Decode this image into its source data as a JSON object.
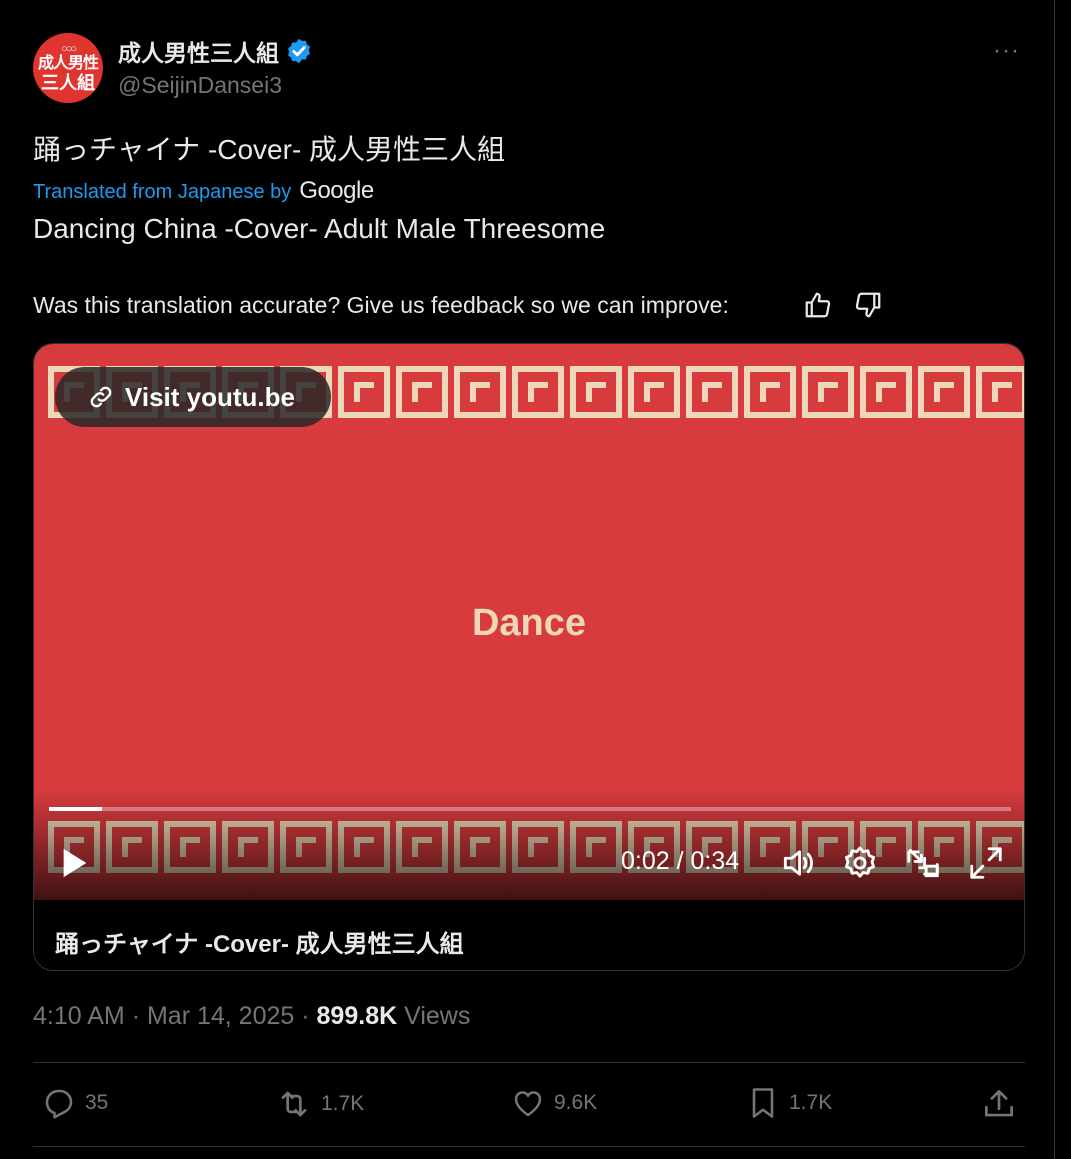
{
  "author": {
    "display_name": "成人男性三人組",
    "handle": "@SeijinDansei3",
    "avatar_line1": "成人男性",
    "avatar_line2": "三人組"
  },
  "more_label": "···",
  "tweet": {
    "text": "踊っチャイナ -Cover- 成人男性三人組",
    "translated_from": "Translated from Japanese by",
    "translator": "Google",
    "translation": "Dancing China -Cover- Adult Male Threesome",
    "feedback_prompt": "Was this translation accurate? Give us feedback so we can improve:"
  },
  "media": {
    "visit_label": "Visit youtu.be",
    "overlay_text": "Dance",
    "time": "0:02 / 0:34",
    "progress_fraction": 0.055,
    "card_title": "踊っチャイナ -Cover- 成人男性三人組",
    "colors": {
      "background": "#d83b3e",
      "pattern": "#eed7b8"
    }
  },
  "meta": {
    "time": "4:10 AM",
    "separator": "·",
    "date": "Mar 14, 2025",
    "views_count": "899.8K",
    "views_label": "Views"
  },
  "actions": {
    "replies": "35",
    "reposts": "1.7K",
    "likes": "9.6K",
    "bookmarks": "1.7K"
  },
  "icons": [
    "verified-icon",
    "more-icon",
    "thumbs-up-icon",
    "thumbs-down-icon",
    "link-icon",
    "play-icon",
    "volume-icon",
    "settings-icon",
    "pip-icon",
    "fullscreen-icon",
    "reply-icon",
    "repost-icon",
    "like-icon",
    "bookmark-icon",
    "share-icon"
  ]
}
